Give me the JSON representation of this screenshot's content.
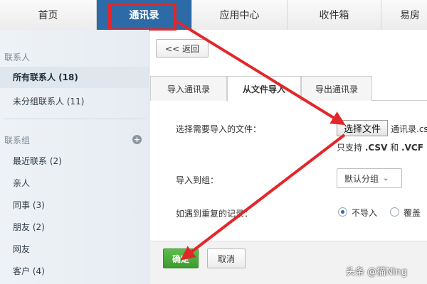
{
  "topnav": {
    "tabs": [
      {
        "label": "首页"
      },
      {
        "label": "通讯录"
      },
      {
        "label": "应用中心"
      },
      {
        "label": "收件箱"
      },
      {
        "label": "易房"
      }
    ],
    "active_index": 1
  },
  "sidebar": {
    "contacts_header": "联系人",
    "all_contacts": "所有联系人 (18)",
    "ungrouped": "未分组联系人 (11)",
    "groups_header": "联系组",
    "groups": [
      {
        "label": "最近联系 (2)"
      },
      {
        "label": "亲人"
      },
      {
        "label": "同事 (3)"
      },
      {
        "label": "朋友 (2)"
      },
      {
        "label": "网友"
      },
      {
        "label": "客户 (4)"
      }
    ]
  },
  "main": {
    "back_label": "<< 返回",
    "tabs": [
      {
        "label": "导入通讯录"
      },
      {
        "label": "从文件导入"
      },
      {
        "label": "导出通讯录"
      }
    ],
    "file_label": "选择需要导入的文件：",
    "choose_button": "选择文件",
    "file_name": "通讯录.csv",
    "support_prefix": "只支持",
    "support_csv": ".CSV",
    "support_and": "和",
    "support_vcf": ".VCF",
    "group_label": "导入到组：",
    "group_select": "默认分组",
    "duplicate_label": "如遇到重复的记录：",
    "radio_skip": "不导入",
    "radio_overwrite": "覆盖",
    "ok_button": "确定",
    "cancel_button": "取消"
  },
  "watermark": "头条 @猫Ning",
  "colors": {
    "nav_active": "#2c6ba7",
    "highlight_red": "#e3262a",
    "ok_green": "#4aac3a"
  }
}
